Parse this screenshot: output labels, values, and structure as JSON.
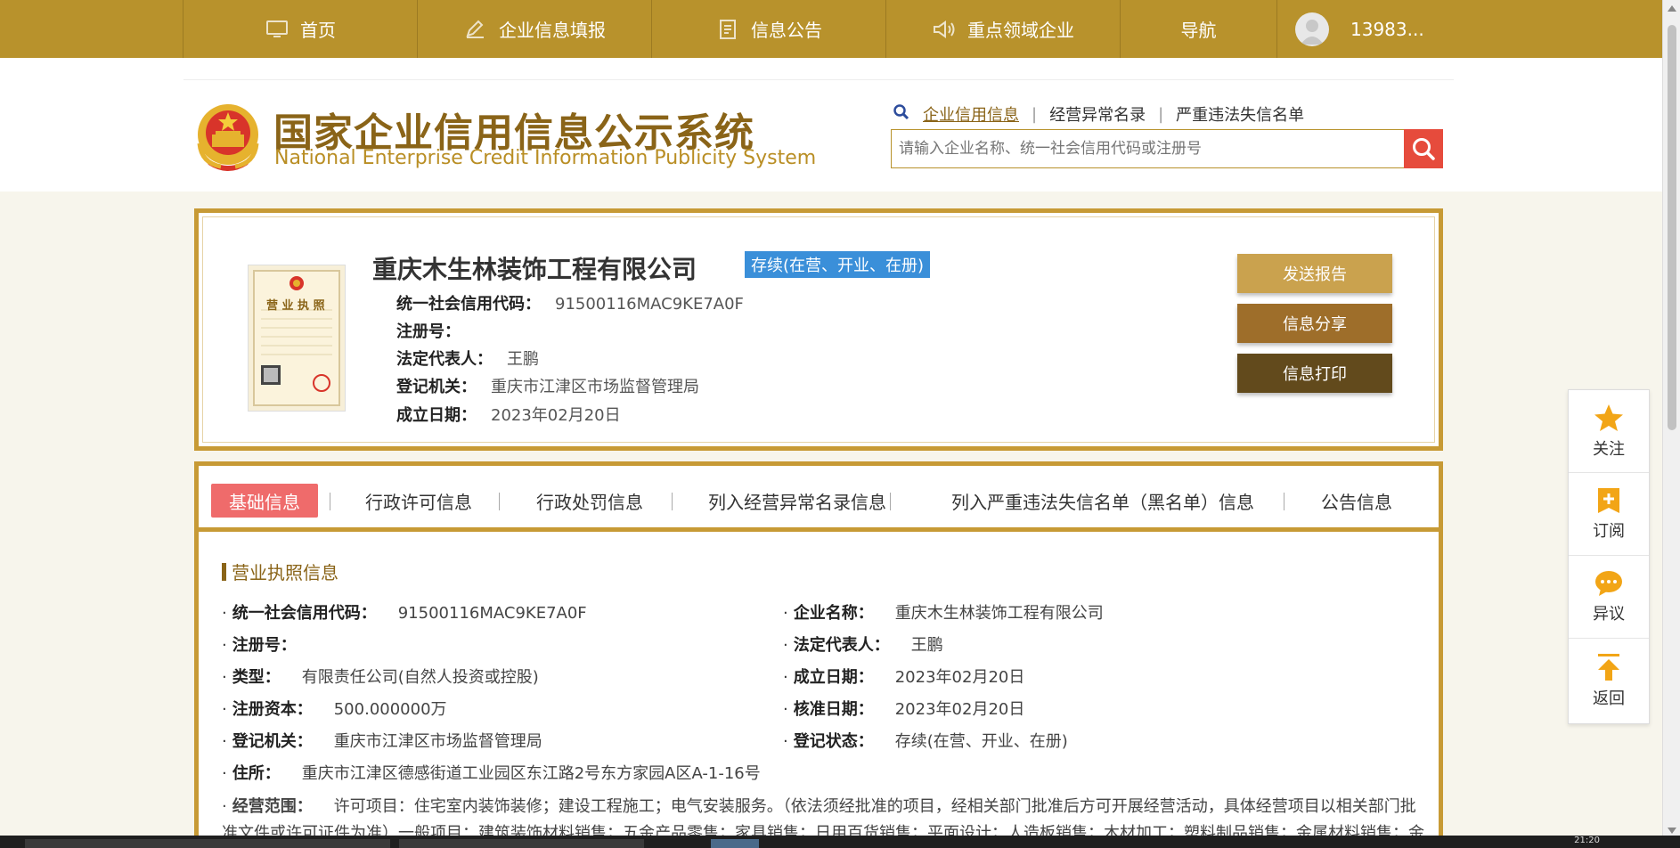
{
  "nav": {
    "items": [
      {
        "label": "首页",
        "icon": "monitor-icon"
      },
      {
        "label": "企业信息填报",
        "icon": "edit-icon"
      },
      {
        "label": "信息公告",
        "icon": "document-icon"
      },
      {
        "label": "重点领域企业",
        "icon": "speaker-icon"
      },
      {
        "label": "导航",
        "icon": ""
      }
    ],
    "user": "13983..."
  },
  "header": {
    "title_cn": "国家企业信用信息公示系统",
    "title_en": "National Enterprise Credit Information Publicity System",
    "links": [
      "企业信用信息",
      "经营异常名录",
      "严重违法失信名单"
    ],
    "search_placeholder": "请输入企业名称、统一社会信用代码或注册号"
  },
  "company": {
    "name": "重庆木生林装饰工程有限公司",
    "status": "存续(在营、开业、在册)",
    "license_title": "营 业 执 照",
    "fields": [
      {
        "label": "统一社会信用代码：",
        "value": "91500116MAC9KE7A0F"
      },
      {
        "label": "注册号：",
        "value": ""
      },
      {
        "label": "法定代表人：",
        "value": "王鹏"
      },
      {
        "label": "登记机关：",
        "value": "重庆市江津区市场监督管理局"
      },
      {
        "label": "成立日期：",
        "value": "2023年02月20日"
      }
    ],
    "buttons": [
      "发送报告",
      "信息分享",
      "信息打印"
    ]
  },
  "tabs": [
    "基础信息",
    "行政许可信息",
    "行政处罚信息",
    "列入经营异常名录信息",
    "列入严重违法失信名单（黑名单）信息",
    "公告信息"
  ],
  "section": {
    "title": "营业执照信息",
    "left": [
      {
        "label": "统一社会信用代码：",
        "value": "91500116MAC9KE7A0F"
      },
      {
        "label": "注册号：",
        "value": ""
      },
      {
        "label": "类型：",
        "value": "有限责任公司(自然人投资或控股)"
      },
      {
        "label": "注册资本：",
        "value": "500.000000万"
      },
      {
        "label": "登记机关：",
        "value": "重庆市江津区市场监督管理局"
      },
      {
        "label": "住所：",
        "value": "重庆市江津区德感街道工业园区东江路2号东方家园A区A-1-16号"
      }
    ],
    "right": [
      {
        "label": "企业名称：",
        "value": "重庆木生林装饰工程有限公司"
      },
      {
        "label": "法定代表人：",
        "value": "王鹏"
      },
      {
        "label": "成立日期：",
        "value": "2023年02月20日"
      },
      {
        "label": "核准日期：",
        "value": "2023年02月20日"
      },
      {
        "label": "登记状态：",
        "value": "存续(在营、开业、在册)"
      }
    ],
    "scope_label": "经营范围：",
    "scope_value": "许可项目：住宅室内装饰装修；建设工程施工；电气安装服务。（依法须经批准的项目，经相关部门批准后方可开展经营活动，具体经营项目以相关部门批准文件或许可证件为准）一般项目：建筑装饰材料销售；五金产品零售；家具销售；日用百货销售；平面设计；人造板销售；木材加工；塑料制品销售；金属材料销售；金"
  },
  "float": [
    {
      "label": "关注",
      "icon": "star-icon"
    },
    {
      "label": "订阅",
      "icon": "subscribe-icon"
    },
    {
      "label": "异议",
      "icon": "chat-icon"
    },
    {
      "label": "返回",
      "icon": "back-to-top-icon"
    }
  ],
  "taskbar": {
    "clock": "21:20"
  },
  "colors": {
    "gold": "#b8922c",
    "brown": "#8a6418",
    "badge": "#3a8fd9",
    "tab_active": "#ef6b6b"
  }
}
